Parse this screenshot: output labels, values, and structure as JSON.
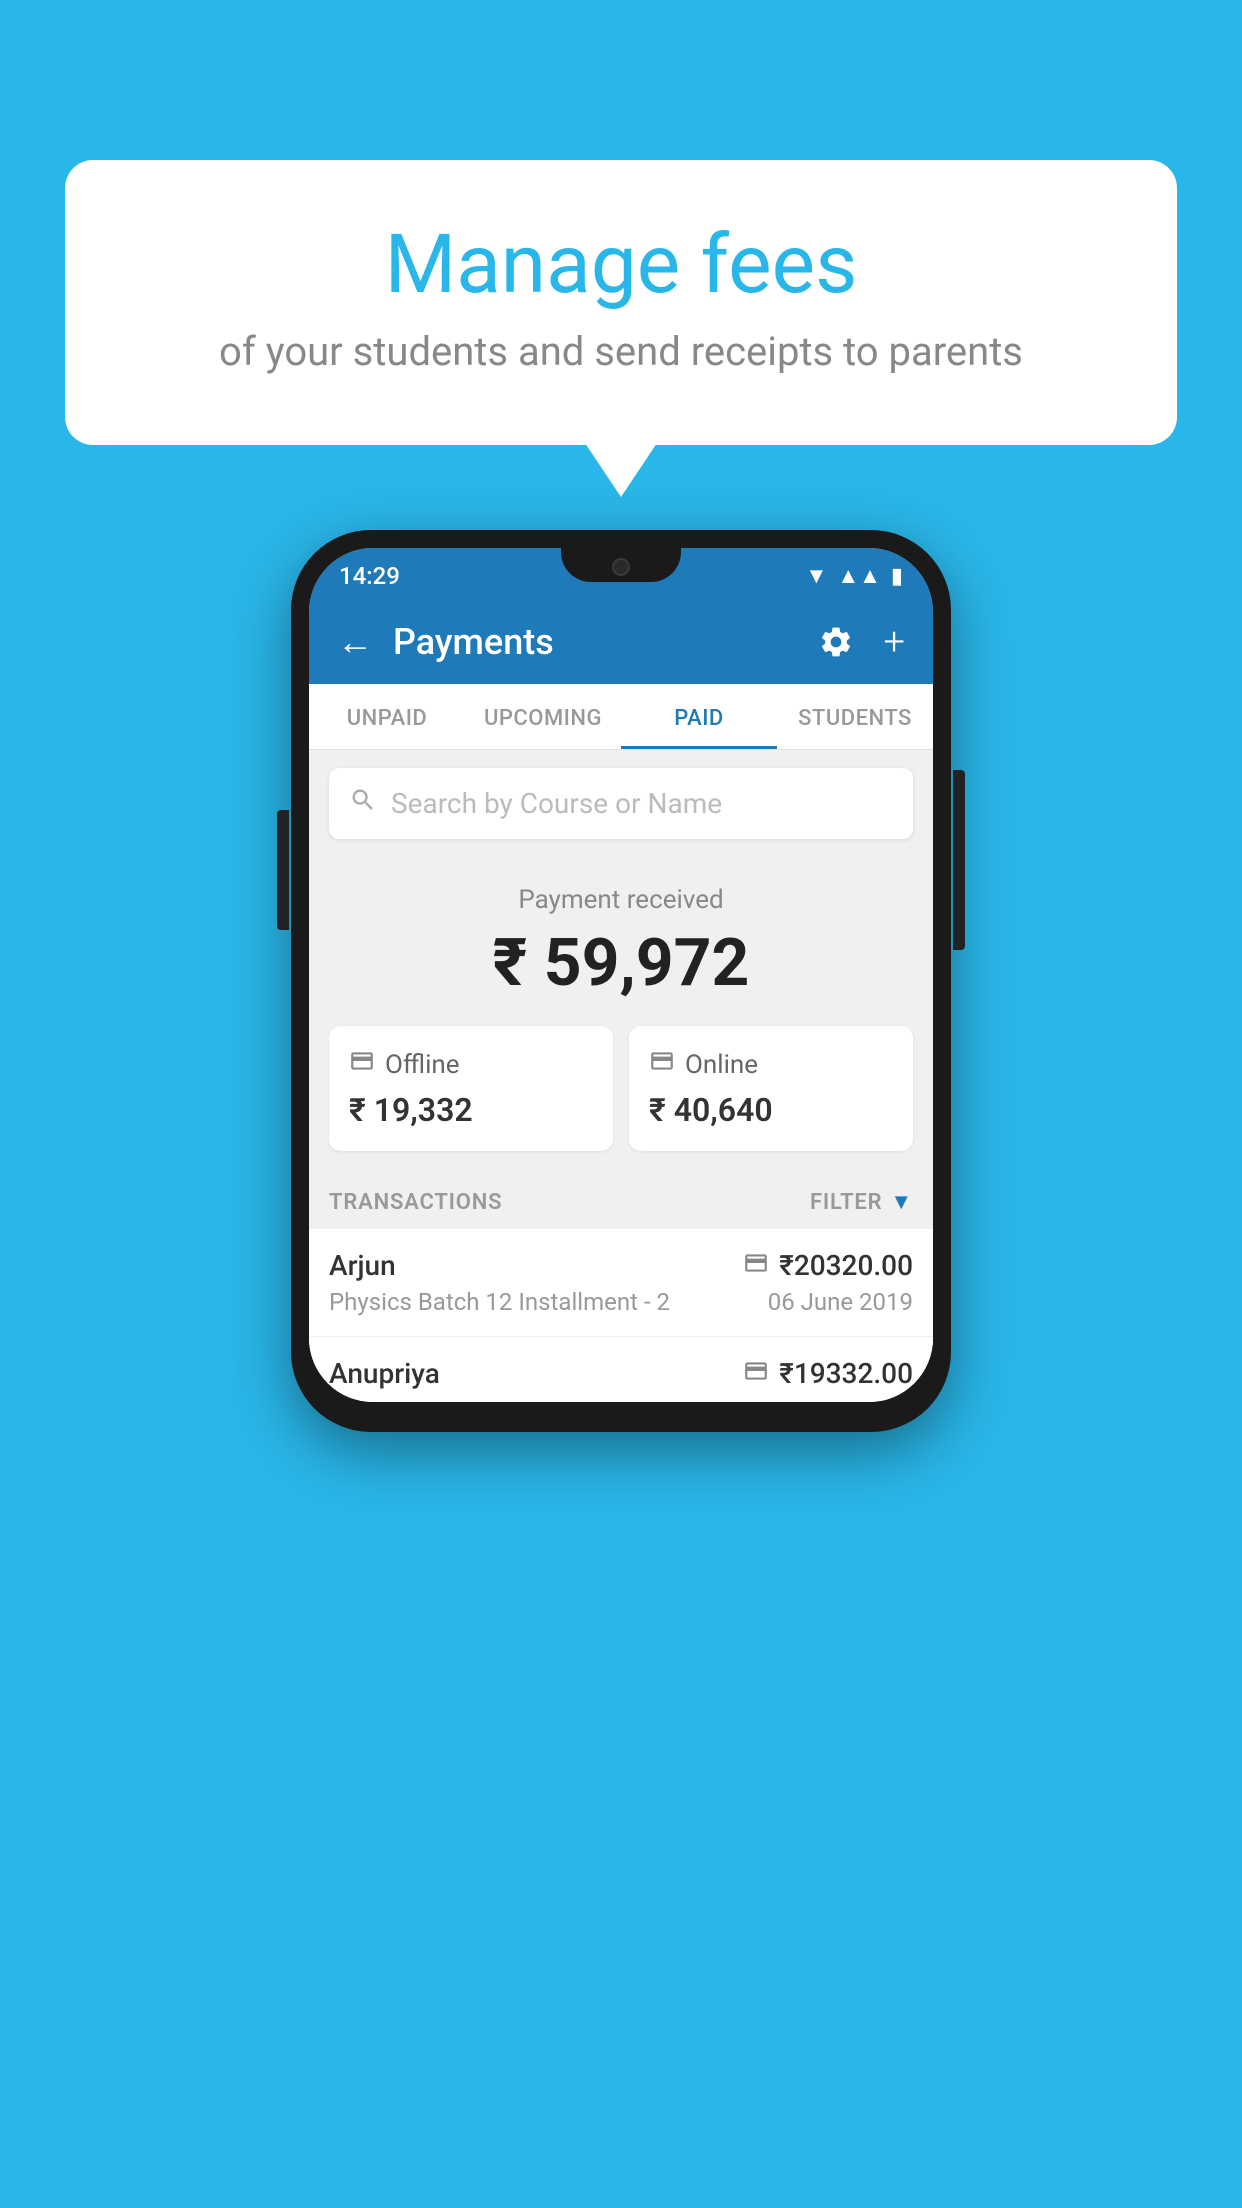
{
  "background_color": "#29b6e8",
  "bubble": {
    "title": "Manage fees",
    "subtitle": "of your students and send receipts to parents"
  },
  "phone": {
    "status_bar": {
      "time": "14:29"
    },
    "app_bar": {
      "title": "Payments"
    },
    "tabs": [
      {
        "id": "unpaid",
        "label": "UNPAID",
        "active": false
      },
      {
        "id": "upcoming",
        "label": "UPCOMING",
        "active": false
      },
      {
        "id": "paid",
        "label": "PAID",
        "active": true
      },
      {
        "id": "students",
        "label": "STUDENTS",
        "active": false
      }
    ],
    "search": {
      "placeholder": "Search by Course or Name"
    },
    "payment_summary": {
      "label": "Payment received",
      "amount": "₹ 59,972"
    },
    "payment_cards": [
      {
        "icon": "offline",
        "type": "Offline",
        "amount": "₹ 19,332"
      },
      {
        "icon": "online",
        "type": "Online",
        "amount": "₹ 40,640"
      }
    ],
    "transactions": {
      "label": "TRANSACTIONS",
      "filter_label": "FILTER",
      "rows": [
        {
          "name": "Arjun",
          "payment_type": "card",
          "amount": "₹20320.00",
          "course": "Physics Batch 12 Installment - 2",
          "date": "06 June 2019"
        },
        {
          "name": "Anupriya",
          "payment_type": "offline",
          "amount": "₹19332.00",
          "course": "",
          "date": ""
        }
      ]
    }
  }
}
